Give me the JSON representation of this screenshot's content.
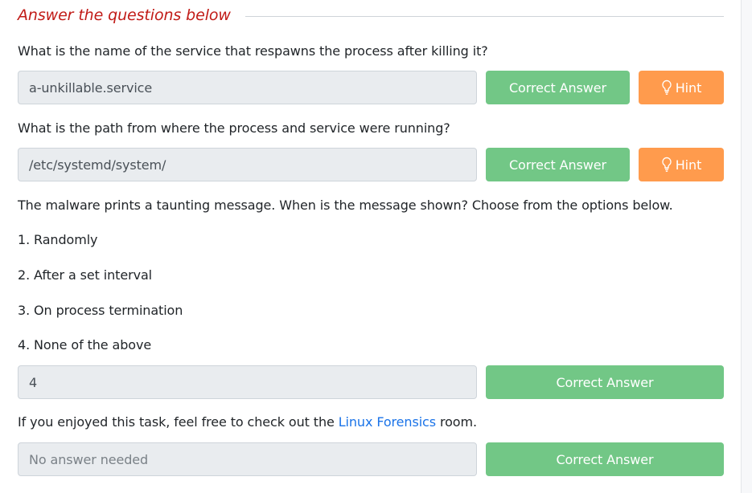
{
  "section": {
    "title": "Answer the questions below"
  },
  "questions": [
    {
      "text": "What is the name of the service that respawns the process after killing it?",
      "answer": "a-unkillable.service",
      "submit_label": "Correct Answer",
      "hint_label": "Hint"
    },
    {
      "text": "What is the path from where the process and service were running?",
      "answer": "/etc/systemd/system/",
      "submit_label": "Correct Answer",
      "hint_label": "Hint"
    },
    {
      "text": "The malware prints a taunting message. When is the message shown? Choose from the options below.",
      "options": [
        "1. Randomly",
        "2. After a set interval",
        "3. On process termination",
        "4. None of the above"
      ],
      "answer": "4",
      "submit_label": "Correct Answer"
    },
    {
      "text_before": "If you enjoyed this task, feel free to check out the ",
      "link_text": "Linux Forensics",
      "text_after": " room.",
      "placeholder": "No answer needed",
      "submit_label": "Correct Answer"
    }
  ],
  "icons": {
    "hint": "lightbulb-icon"
  },
  "colors": {
    "correct": "#72c786",
    "hint": "#ff9b4d",
    "title": "#c11b17",
    "link": "#1a73e8"
  }
}
